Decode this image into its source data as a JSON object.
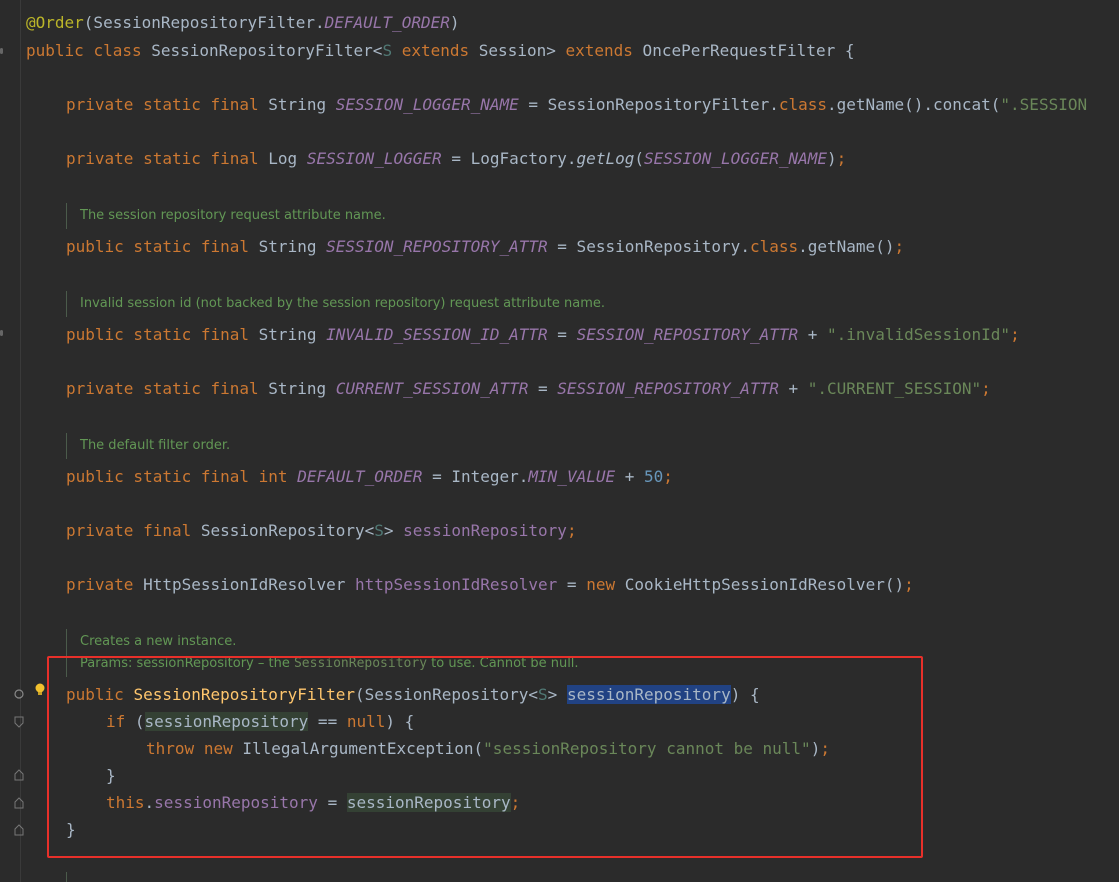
{
  "code": {
    "annotation": {
      "at": "@Order",
      "open": "(SessionRepositoryFilter.",
      "const": "DEFAULT_ORDER",
      "close": ")"
    },
    "class_decl": {
      "public": "public",
      "class": "class",
      "name": " SessionRepositoryFilter<",
      "type_param": "S",
      "extends1": "extends",
      "session": " Session> ",
      "extends2": "extends",
      "super": " OncePerRequestFilter {"
    },
    "logger_name_line": {
      "mods": "private static final",
      "type": " String ",
      "name": "SESSION_LOGGER_NAME",
      "eq": " = SessionRepositoryFilter.",
      "class_kw": "class",
      "rest": ".getName().concat(",
      "str": "\".SESSION"
    },
    "logger_line": {
      "mods": "private static final",
      "type": " Log ",
      "name": "SESSION_LOGGER",
      "eq": " = LogFactory.",
      "method": "getLog",
      "open": "(",
      "arg": "SESSION_LOGGER_NAME",
      "close": ")",
      "semi": ";"
    },
    "doc1": "The session repository request attribute name.",
    "repo_attr_line": {
      "mods": "public static final",
      "type": " String ",
      "name": "SESSION_REPOSITORY_ATTR",
      "eq": " = SessionRepository.",
      "class_kw": "class",
      "rest": ".getName()",
      "semi": ";"
    },
    "doc2": "Invalid session id (not backed by the session repository) request attribute name.",
    "invalid_line": {
      "mods": "public static final",
      "type": " String ",
      "name": "INVALID_SESSION_ID_ATTR",
      "eq": " = ",
      "ref": "SESSION_REPOSITORY_ATTR",
      "plus": " + ",
      "str": "\".invalidSessionId\"",
      "semi": ";"
    },
    "current_line": {
      "mods": "private static final",
      "type": " String ",
      "name": "CURRENT_SESSION_ATTR",
      "eq": " = ",
      "ref": "SESSION_REPOSITORY_ATTR",
      "plus": " + ",
      "str": "\".CURRENT_SESSION\"",
      "semi": ";"
    },
    "doc3": "The default filter order.",
    "order_line": {
      "mods": "public static final int",
      "name": "DEFAULT_ORDER",
      "eq": " = Integer.",
      "const": "MIN_VALUE",
      "plus": " + ",
      "num": "50",
      "semi": ";"
    },
    "repo_field_line": {
      "mods": "private final",
      "type": " SessionRepository<",
      "tp": "S",
      "close": "> ",
      "name": "sessionRepository",
      "semi": ";"
    },
    "resolver_line": {
      "mod": "private",
      "type": " HttpSessionIdResolver ",
      "name": "httpSessionIdResolver",
      "eq": " = ",
      "new": "new",
      "rest": " CookieHttpSessionIdResolver()",
      "semi": ";"
    },
    "doc4": "Creates a new instance.",
    "doc5": {
      "pre": "Params: sessionRepository – the ",
      "ref": "SessionRepository",
      "post": " to use. Cannot be null."
    },
    "ctor_line": {
      "mod": "public",
      "name": "SessionRepositoryFilter",
      "open": "(SessionRepository<",
      "tp": "S",
      "close": "> ",
      "param": "sessionRepository",
      "end": ") {"
    },
    "if_line": {
      "kw": "if",
      "open": " (",
      "var": "sessionRepository",
      "eq": " == ",
      "null": "null",
      "end": ") {"
    },
    "throw_line": {
      "throw": "throw",
      "new": "new",
      "cls": " IllegalArgumentException(",
      "str": "\"sessionRepository cannot be null\"",
      "close": ")",
      "semi": ";"
    },
    "close_brace1": "}",
    "assign_line": {
      "this": "this",
      "dot": ".",
      "field": "sessionRepository",
      "eq": " = ",
      "var": "sessionRepository",
      "semi": ";"
    },
    "close_brace2": "}"
  },
  "colors": {
    "background": "#2b2b2b",
    "keyword": "#cc7832",
    "field": "#9876aa",
    "string": "#6a8759",
    "number": "#6897bb",
    "method": "#ffc66d",
    "annotation": "#bbb529",
    "doc": "#629755",
    "highlight_box": "#e8302a",
    "selection": "#214283"
  },
  "icons": {
    "lightbulb": "lightbulb-icon",
    "fold": "fold-icon",
    "override": "override-icon"
  }
}
